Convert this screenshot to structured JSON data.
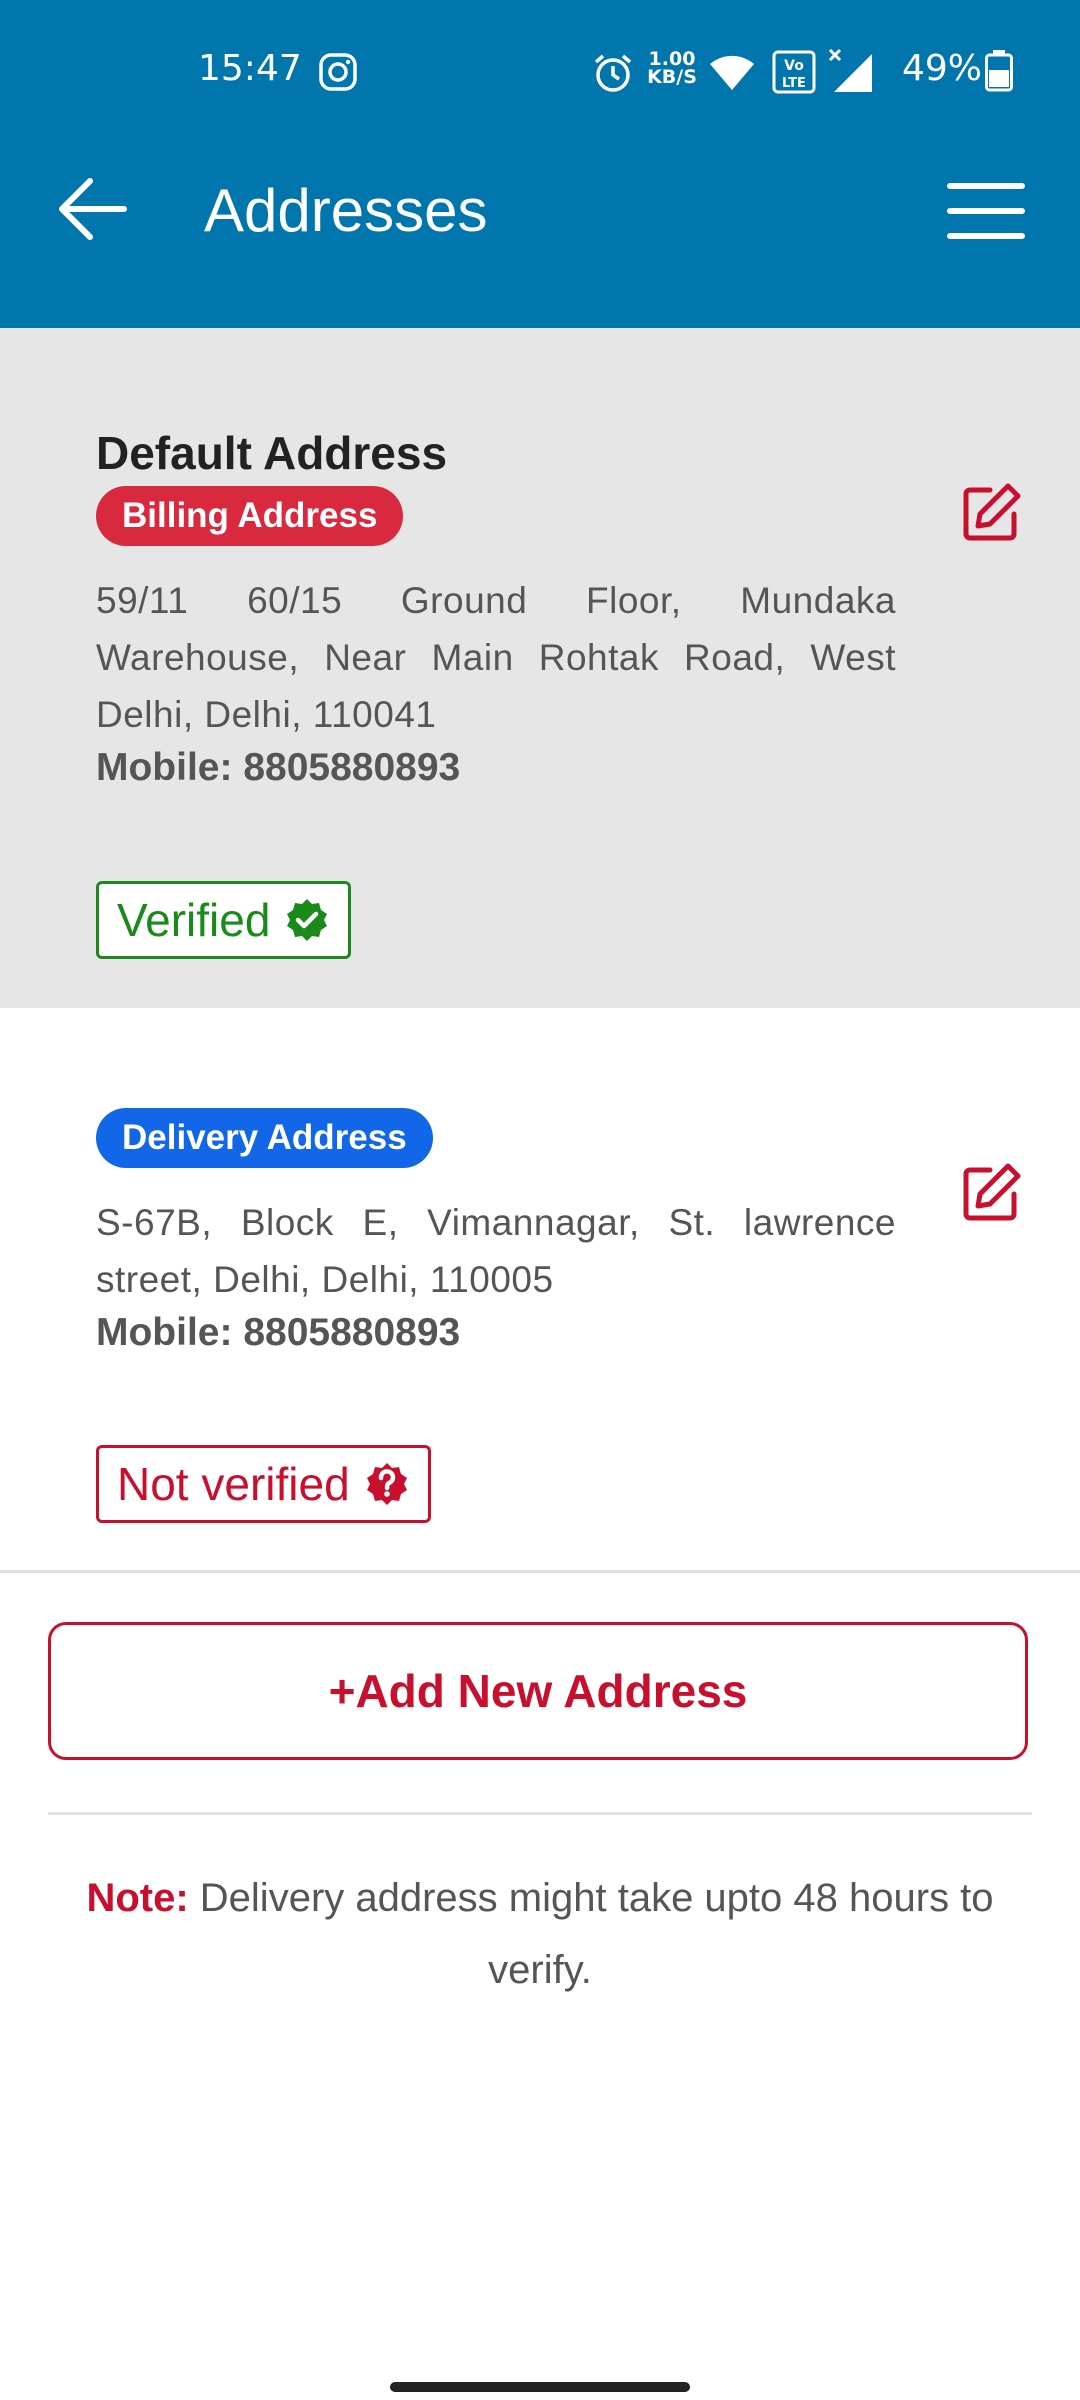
{
  "status_bar": {
    "time": "15:47",
    "net_speed_value": "1.00",
    "net_speed_unit": "KB/S",
    "battery": "49%",
    "icons": [
      "instagram-icon",
      "alarm-icon",
      "wifi-icon",
      "volte-icon",
      "signal-icon",
      "battery-icon"
    ]
  },
  "app_bar": {
    "title": "Addresses",
    "color": "#0076ad"
  },
  "addresses": [
    {
      "heading": "Default Address",
      "tag": "Billing Address",
      "tag_color": "#d9293f",
      "address": "59/11 60/15 Ground Floor, Mundaka Warehouse, Near Main Rohtak Road, West Delhi, Delhi, 110041",
      "mobile": "Mobile: 8805880893",
      "status": "Verified",
      "status_color": "#1a8a1a"
    },
    {
      "tag": "Delivery Address",
      "tag_color": "#1167e8",
      "address": "S-67B, Block E, Vimannagar, St. lawrence street, Delhi, Delhi, 110005",
      "mobile": "Mobile: 8805880893",
      "status": "Not verified",
      "status_color": "#c8102e"
    }
  ],
  "add_button": "+Add New Address",
  "note": {
    "label": "Note:",
    "text": " Delivery address might take upto 48 hours to verify."
  },
  "accent_color": "#c8102e"
}
